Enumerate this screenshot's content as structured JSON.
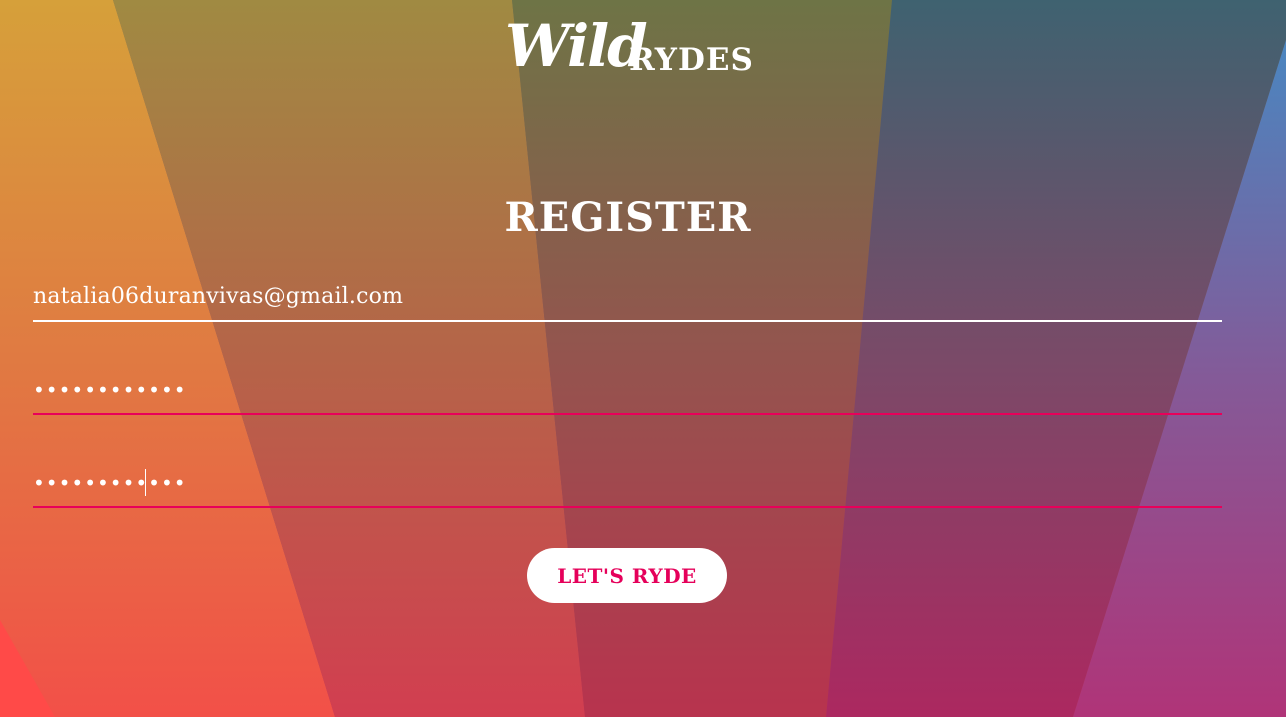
{
  "logo": {
    "script_text": "Wild",
    "caps_text": "RYDES"
  },
  "page": {
    "title": "REGISTER"
  },
  "form": {
    "email_value": "natalia06duranvivas@gmail.com",
    "password_value": "••••••••••••",
    "confirm_password_value": "••••••••••••",
    "submit_label": "LET'S RYDE"
  },
  "colors": {
    "accent": "#e8005a",
    "text": "#ffffff",
    "button_bg": "#ffffff",
    "button_text": "#e5005a"
  }
}
